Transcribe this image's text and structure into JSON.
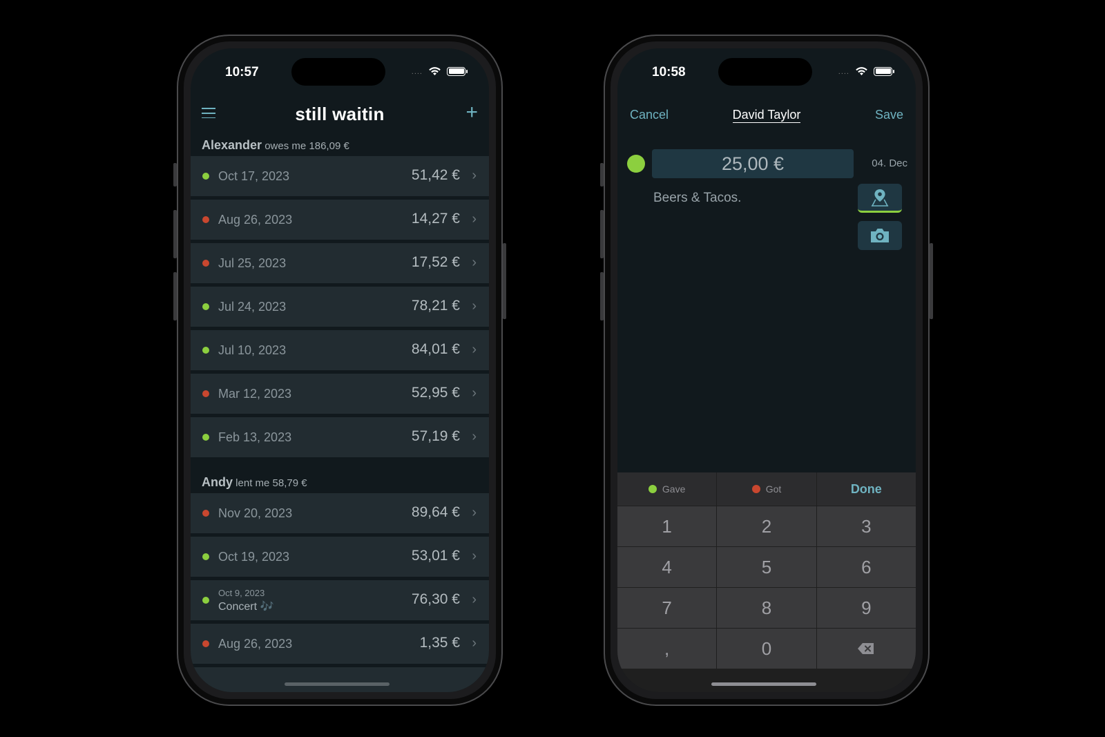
{
  "colors": {
    "accent": "#6fb3c1",
    "gave_green": "#8ccf3f",
    "got_red": "#c9472f",
    "background": "#11191d",
    "row_bg": "#222c31"
  },
  "left_phone": {
    "status": {
      "time": "10:57",
      "signal_dots": "....",
      "wifi_icon": "wifi-icon",
      "battery_icon": "battery-icon"
    },
    "nav": {
      "menu_icon": "hamburger-menu-icon",
      "title": "still waitin",
      "add_icon": "plus-icon"
    },
    "sections": [
      {
        "name": "Alexander",
        "summary": "owes me 186,09 €",
        "rows": [
          {
            "status": "gave",
            "date": "Oct 17, 2023",
            "amount": "51,42 €"
          },
          {
            "status": "got",
            "date": "Aug 26, 2023",
            "amount": "14,27 €"
          },
          {
            "status": "got",
            "date": "Jul 25, 2023",
            "amount": "17,52 €"
          },
          {
            "status": "gave",
            "date": "Jul 24, 2023",
            "amount": "78,21 €"
          },
          {
            "status": "gave",
            "date": "Jul 10, 2023",
            "amount": "84,01 €"
          },
          {
            "status": "got",
            "date": "Mar 12, 2023",
            "amount": "52,95 €"
          },
          {
            "status": "gave",
            "date": "Feb 13, 2023",
            "amount": "57,19 €"
          }
        ]
      },
      {
        "name": "Andy",
        "summary": "lent me 58,79 €",
        "rows": [
          {
            "status": "got",
            "date": "Nov 20, 2023",
            "amount": "89,64 €"
          },
          {
            "status": "gave",
            "date": "Oct 19, 2023",
            "amount": "53,01 €"
          },
          {
            "status": "gave",
            "date": "Oct 9, 2023",
            "note": "Concert 🎶",
            "amount": "76,30 €"
          },
          {
            "status": "got",
            "date": "Aug 26, 2023",
            "amount": "1,35 €"
          }
        ]
      }
    ],
    "chevron": "›"
  },
  "right_phone": {
    "status": {
      "time": "10:58",
      "signal_dots": "...."
    },
    "nav": {
      "cancel": "Cancel",
      "title": "David Taylor",
      "save": "Save"
    },
    "entry": {
      "amount": "25,00 €",
      "date": "04. Dec",
      "note": "Beers & Tacos.",
      "status": "gave"
    },
    "tools": {
      "location_icon": "map-pin-icon",
      "camera_icon": "camera-icon"
    },
    "keypad": {
      "gave_label": "Gave",
      "got_label": "Got",
      "done_label": "Done",
      "keys": [
        "1",
        "2",
        "3",
        "4",
        "5",
        "6",
        "7",
        "8",
        "9",
        ",",
        "0",
        "⌫"
      ]
    }
  }
}
